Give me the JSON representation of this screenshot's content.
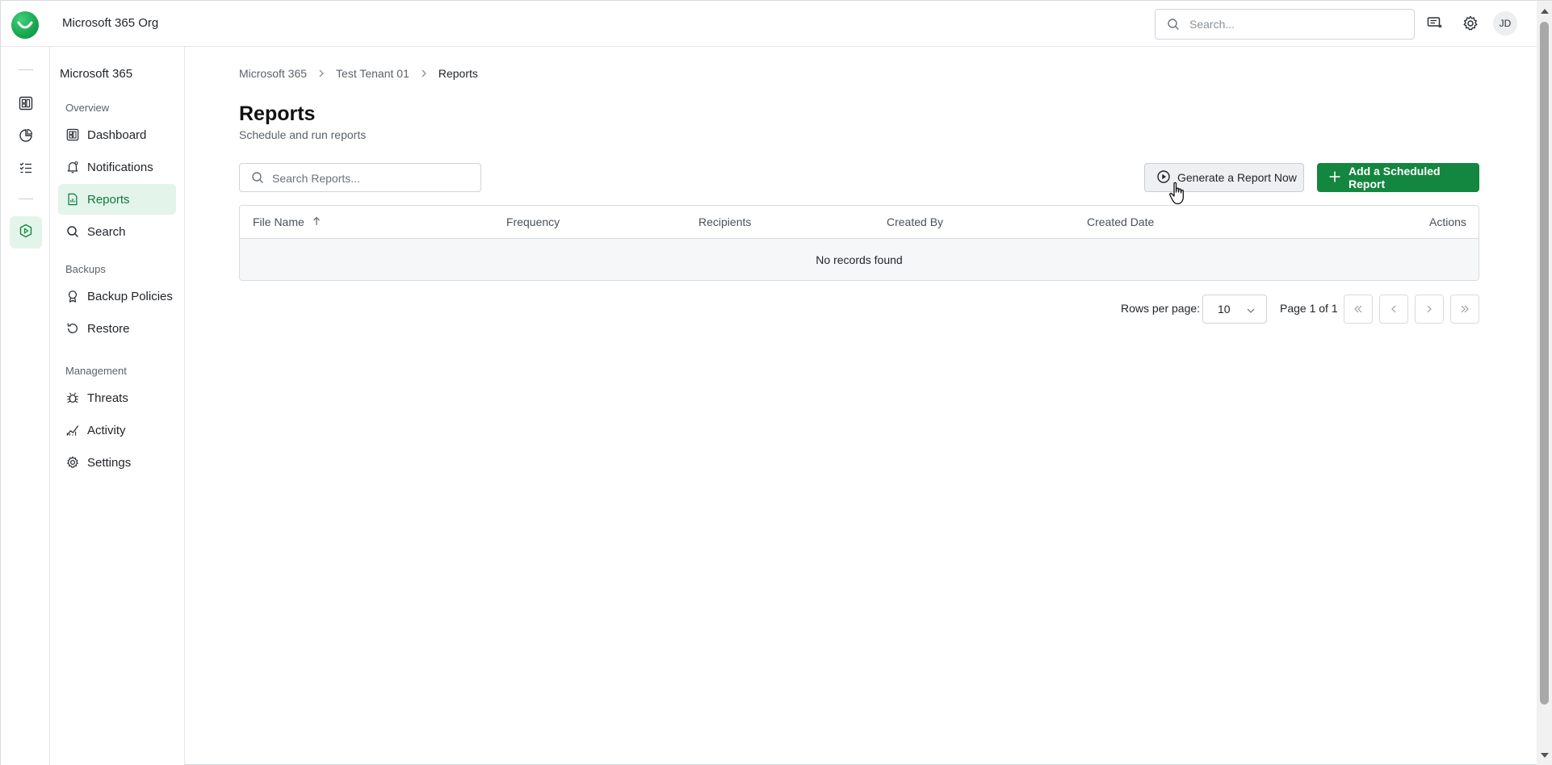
{
  "colors": {
    "brand_green": "#13863f",
    "active_bg": "#e3f5ea",
    "active_text": "#0f7a3b",
    "border": "#d7dbe0"
  },
  "header": {
    "org_name": "Microsoft 365 Org",
    "search_placeholder": "Search...",
    "icons": [
      "messages-icon",
      "gear-icon"
    ],
    "avatar_initials": "JD"
  },
  "rail": {
    "icons": [
      "dashboard-icon",
      "chart-icon",
      "task-list-icon",
      "shield-play-icon"
    ]
  },
  "sidebar": {
    "title": "Microsoft 365",
    "sections": [
      {
        "label": "Overview",
        "items": [
          {
            "label": "Dashboard",
            "icon": "dashboard-icon"
          },
          {
            "label": "Notifications",
            "icon": "bell-icon"
          },
          {
            "label": "Reports",
            "icon": "report-icon",
            "active": true
          },
          {
            "label": "Search",
            "icon": "search-icon"
          }
        ]
      },
      {
        "label": "Backups",
        "items": [
          {
            "label": "Backup Policies",
            "icon": "badge-icon"
          },
          {
            "label": "Restore",
            "icon": "restore-icon"
          }
        ]
      },
      {
        "label": "Management",
        "items": [
          {
            "label": "Threats",
            "icon": "bug-icon"
          },
          {
            "label": "Activity",
            "icon": "activity-icon"
          },
          {
            "label": "Settings",
            "icon": "gear-icon"
          }
        ]
      }
    ]
  },
  "breadcrumb": [
    "Microsoft 365",
    "Test Tenant 01",
    "Reports"
  ],
  "page": {
    "title": "Reports",
    "subtitle": "Schedule and run reports"
  },
  "toolbar": {
    "search_placeholder": "Search Reports...",
    "generate_label": "Generate a Report Now",
    "add_label": "Add a Scheduled Report"
  },
  "table": {
    "columns": [
      "File Name",
      "Frequency",
      "Recipients",
      "Created By",
      "Created Date",
      "Actions"
    ],
    "sort_column": "File Name",
    "sort_direction": "ascending",
    "empty_message": "No records found"
  },
  "pagination": {
    "rows_label": "Rows per page:",
    "rows_value": "10",
    "page_info": "Page 1 of 1"
  }
}
